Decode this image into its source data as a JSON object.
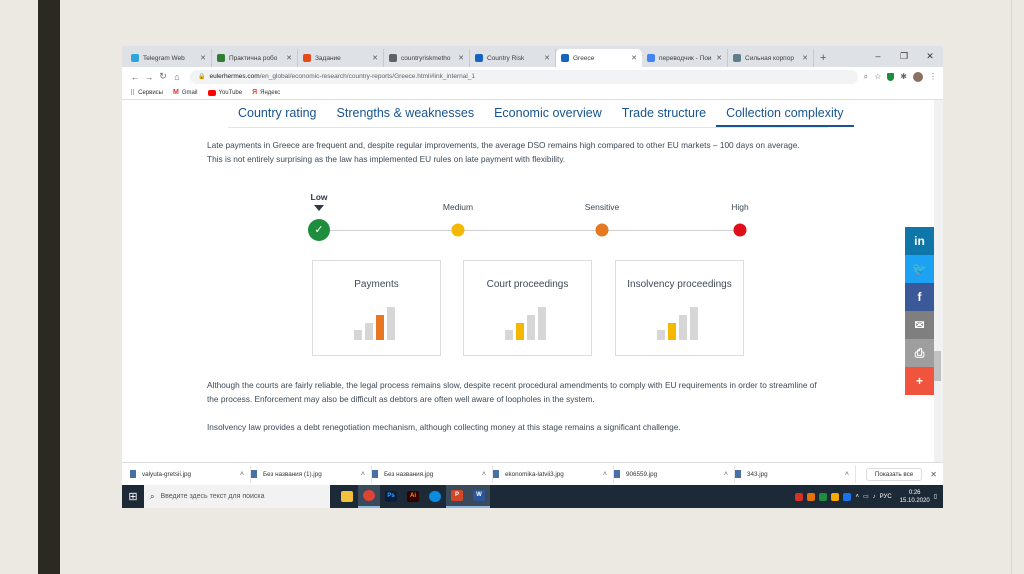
{
  "browser": {
    "tabs": [
      {
        "label": "Telegram Web",
        "fav_color": "#2ca5e0",
        "active": false
      },
      {
        "label": "Практична робо",
        "fav_color": "#2e7d32",
        "active": false
      },
      {
        "label": "Задание",
        "fav_color": "#e64a19",
        "active": false
      },
      {
        "label": "countryriskmetho",
        "fav_color": "#5f6368",
        "active": false
      },
      {
        "label": "Country Risk",
        "fav_color": "#1565c0",
        "active": false
      },
      {
        "label": "Greece",
        "fav_color": "#1565c0",
        "active": true
      },
      {
        "label": "переводчик - Пои",
        "fav_color": "#4285f4",
        "active": false
      },
      {
        "label": "Сильная корпор",
        "fav_color": "#607d8b",
        "active": false
      }
    ],
    "new_tab": "+",
    "url_host": "eulerhermes.com",
    "url_path": "/en_global/economic-research/country-reports/Greece.html#link_internal_1",
    "bookmarks": [
      "Сервисы",
      "Gmail",
      "YouTube",
      "Яндекс"
    ]
  },
  "page": {
    "subnav": [
      "Country rating",
      "Strengths & weaknesses",
      "Economic overview",
      "Trade structure",
      "Collection complexity"
    ],
    "active_subnav": "Collection complexity",
    "intro": "Late payments in Greece are frequent and, despite regular improvements, the average DSO remains high compared to other EU markets – 100 days on average. This is not entirely surprising as the law has implemented EU rules on late payment with flexibility.",
    "scale": [
      {
        "label": "Low",
        "color": "#1e8e3e",
        "selected": true
      },
      {
        "label": "Medium",
        "color": "#f5b800",
        "selected": false
      },
      {
        "label": "Sensitive",
        "color": "#e87722",
        "selected": false
      },
      {
        "label": "High",
        "color": "#e0101a",
        "selected": false
      }
    ],
    "cards": [
      {
        "title": "Payments",
        "level": 3,
        "active_color": "#e87722"
      },
      {
        "title": "Court proceedings",
        "level": 2,
        "active_color": "#f5b800"
      },
      {
        "title": "Insolvency proceedings",
        "level": 2,
        "active_color": "#f5b800"
      }
    ],
    "para2": "Although the courts are fairly reliable, the legal process remains slow, despite recent procedural amendments to comply with EU requirements in order to streamline of the process. Enforcement may also be difficult as debtors are often well aware of loopholes in the system.",
    "para3": "Insolvency law provides a debt renegotiation mechanism, although collecting money at this stage remains a significant challenge.",
    "social": [
      {
        "icon": "linkedin-icon",
        "glyph": "in",
        "color": "#0e76a8"
      },
      {
        "icon": "twitter-icon",
        "glyph": "🐦",
        "color": "#1da1f2"
      },
      {
        "icon": "facebook-icon",
        "glyph": "f",
        "color": "#3b5998"
      },
      {
        "icon": "email-icon",
        "glyph": "✉",
        "color": "#7f7f7f"
      },
      {
        "icon": "print-icon",
        "glyph": "⎙",
        "color": "#9e9e9e"
      },
      {
        "icon": "plus-icon",
        "glyph": "+",
        "color": "#f0543c"
      }
    ]
  },
  "downloads": {
    "items": [
      "valyuta-gretsii.jpg",
      "Без названия (1).jpg",
      "Без названия.jpg",
      "ekonomika-latvii3.jpg",
      "906559.jpg",
      "343.jpg"
    ],
    "show_all": "Показать все"
  },
  "taskbar": {
    "search_placeholder": "Введите здесь текст для поиска",
    "language": "РУС",
    "time": "0:26",
    "date": "15.10.2020"
  }
}
